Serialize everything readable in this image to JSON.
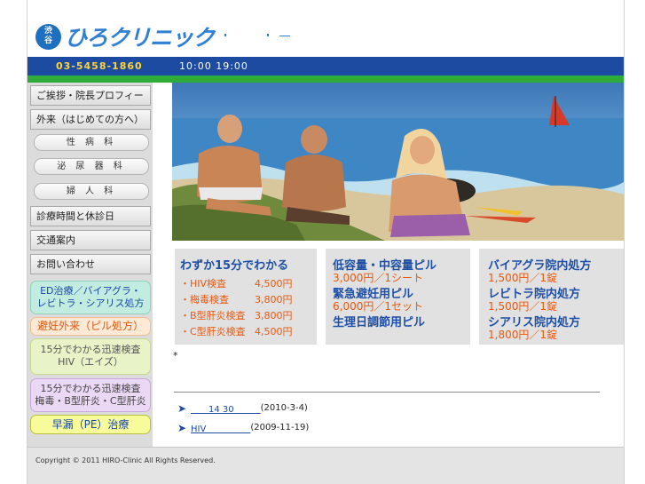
{
  "header": {
    "logo_badge_top": "渋",
    "logo_badge_bottom": "谷",
    "logo_text": "ひろクリニック",
    "phone": "03-5458-1860",
    "hours": "10:00 19:00"
  },
  "sidebar": {
    "nav": [
      {
        "label": "ご挨拶・院長プロフィール"
      },
      {
        "label": "外来（はじめての方へ）"
      },
      {
        "label": "性 病 科"
      },
      {
        "label": "泌 尿 器 科"
      },
      {
        "label": "婦 人 科"
      },
      {
        "label": "診療時間と休診日"
      },
      {
        "label": "交通案内"
      },
      {
        "label": "お問い合わせ"
      }
    ],
    "promos": {
      "ed_line1": "ED治療／バイアグラ・",
      "ed_line2": "レビトラ・シアリス処方",
      "pill": "避妊外来（ピル処方）",
      "hiv_line1": "15分でわかる迅速検査",
      "hiv_line2": "HIV（エイズ）",
      "std_line1": "15分でわかる迅速検査",
      "std_line2": "梅毒・B型肝炎・C型肝炎",
      "pe": "早漏（PE）治療"
    }
  },
  "boxes": {
    "test": {
      "title": "わずか15分でわかる",
      "items": [
        {
          "name": "・HIV検査",
          "price": "4,500円"
        },
        {
          "name": "・梅毒検査",
          "price": "3,800円"
        },
        {
          "name": "・B型肝炎検査",
          "price": "3,800円"
        },
        {
          "name": "・C型肝炎検査",
          "price": "4,500円"
        }
      ]
    },
    "pill": {
      "title1": "低容量・中容量ピル",
      "price1": "3,000円／1シート",
      "title2": "緊急避妊用ピル",
      "price2": "6,000円／1セット",
      "title3": "生理日調節用ピル"
    },
    "ed": {
      "title1": "バイアグラ院内処方",
      "price1": "1,500円／1錠",
      "title2": "レビトラ院内処方",
      "price2": "1,500円／1錠",
      "title3": "シアリス院内処方",
      "price3": "1,800円／1錠"
    }
  },
  "main": {
    "asterisk": "*"
  },
  "news": [
    {
      "link": "　　14 30　　　",
      "date": "(2010-3-4)"
    },
    {
      "link": "HIV　　　　　",
      "date": "(2009-11-19)"
    }
  ],
  "footer": {
    "copyright": "Copyright © 2011 HIRO-Clinic All Rights Reserved."
  },
  "colors": {
    "navy": "#1c4ba1",
    "green": "#2eac3a",
    "phone_yellow": "#ffd535",
    "price_orange": "#e65a12",
    "title_blue": "#1e4fa6"
  }
}
